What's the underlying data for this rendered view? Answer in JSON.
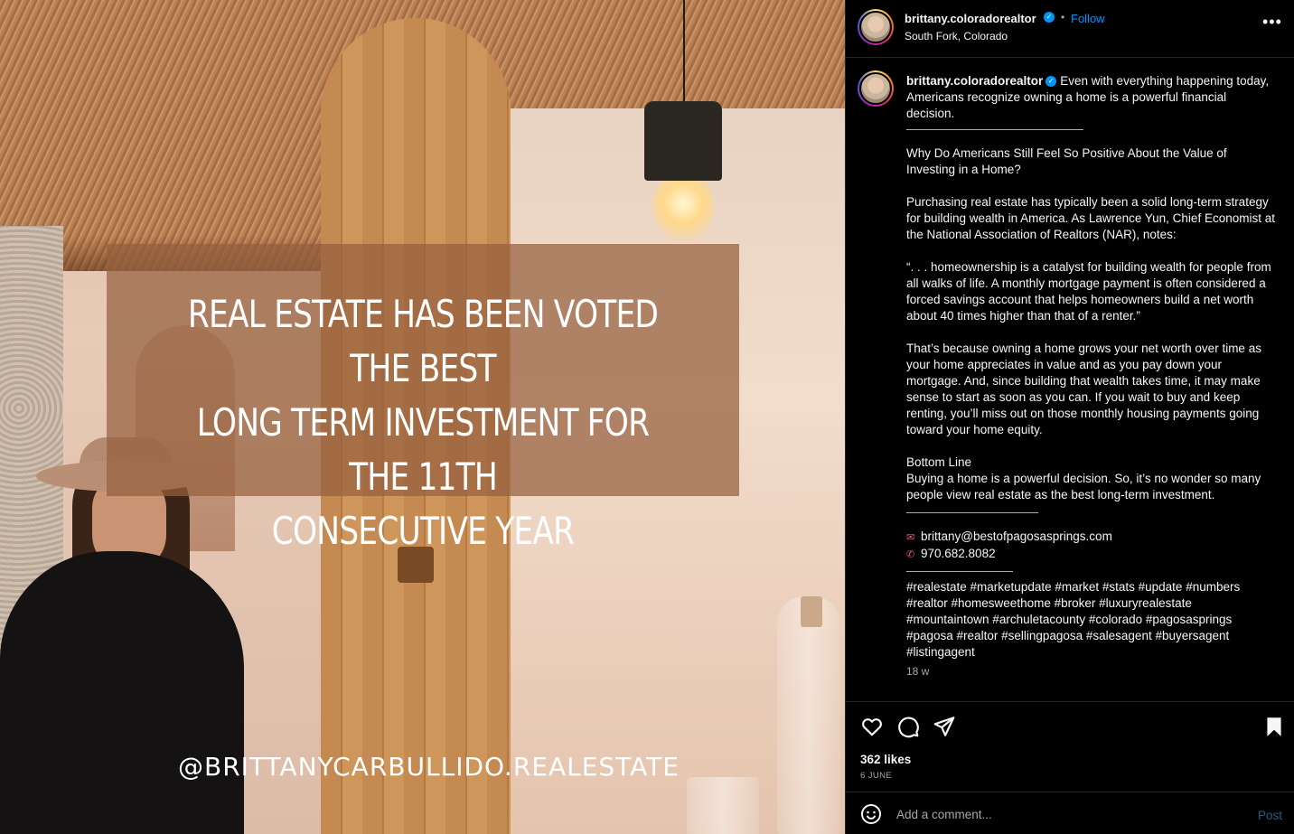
{
  "media": {
    "overlay_text": [
      "REAL ESTATE HAS BEEN  VOTED THE BEST",
      "LONG TERM INVESTMENT FOR THE 11TH",
      "CONSECUTIVE YEAR"
    ],
    "handle_text": "@BRITTANYCARBULLIDO.REALESTATE"
  },
  "header": {
    "username": "brittany.coloradorealtor",
    "verified_icon": "verified-badge-icon",
    "separator": "•",
    "follow_label": "Follow",
    "location": "South Fork, Colorado",
    "more_label": "•••"
  },
  "caption": {
    "username": "brittany.coloradorealtor",
    "intro": "Even with everything happening today, Americans recognize owning a home is a powerful financial decision.",
    "heading": "Why Do Americans Still Feel So Positive About the Value of Investing in a Home?",
    "para1": "Purchasing real estate has typically been a solid long-term strategy for building wealth in America. As Lawrence Yun, Chief Economist at the National Association of Realtors (NAR), notes:",
    "quote": "“. . . homeownership is a catalyst for building wealth for people from all walks of life. A monthly mortgage payment is often considered a forced savings account that helps homeowners build a net worth about 40 times higher than that of a renter.”",
    "para2": "That’s because owning a home grows your net worth over time as your home appreciates in value and as you pay down your mortgage. And, since building that wealth takes time, it may make sense to start as soon as you can. If you wait to buy and keep renting, you’ll miss out on those monthly housing payments going toward your home equity.",
    "bottom_line_title": "Bottom Line",
    "bottom_line": "Buying a home is a powerful decision. So, it’s no wonder so many people view real estate as the best long-term investment.",
    "email": "brittany@bestofpagosasprings.com",
    "phone": "970.682.8082",
    "hashtags": "#realestate #marketupdate #market #stats #update #numbers #realtor #homesweethome #broker #luxuryrealestate #mountaintown #archuletacounty #colorado #pagosasprings #pagosa #realtor #sellingpagosa #salesagent #buyersagent #listingagent",
    "time_ago": "18 w"
  },
  "actions": {
    "likes": "362 likes",
    "date": "6 JUNE"
  },
  "comment": {
    "placeholder": "Add a comment...",
    "post_label": "Post"
  },
  "colors": {
    "accent": "#0095f6",
    "background": "#000000",
    "muted": "#a8a8a8",
    "banner": "#96603e"
  }
}
